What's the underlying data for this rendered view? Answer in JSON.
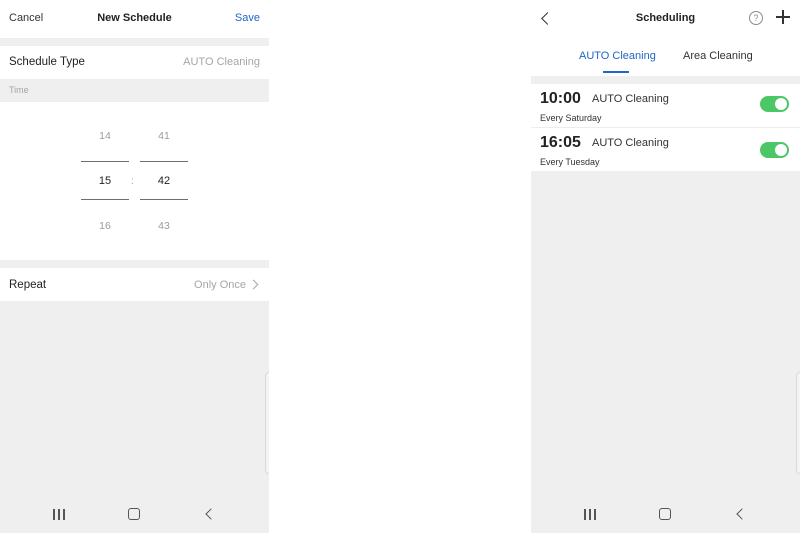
{
  "new_schedule": {
    "header": {
      "cancel": "Cancel",
      "title": "New Schedule",
      "save": "Save"
    },
    "schedule_type": {
      "label": "Schedule Type",
      "value": "AUTO Cleaning"
    },
    "time_section_label": "Time",
    "time_picker": {
      "hours": [
        "14",
        "15",
        "16"
      ],
      "minutes": [
        "41",
        "42",
        "43"
      ],
      "separator": ":"
    },
    "repeat": {
      "label": "Repeat",
      "value": "Only Once"
    }
  },
  "scheduling": {
    "header": {
      "title": "Scheduling",
      "help": "?"
    },
    "tabs": [
      {
        "label": "AUTO Cleaning",
        "active": true
      },
      {
        "label": "Area Cleaning",
        "active": false
      }
    ],
    "schedules": [
      {
        "time": "10:00",
        "type": "AUTO Cleaning",
        "repeat": "Every Saturday",
        "enabled": true
      },
      {
        "time": "16:05",
        "type": "AUTO Cleaning",
        "repeat": "Every Tuesday",
        "enabled": true
      }
    ]
  },
  "colors": {
    "accent": "#1f66c6",
    "toggle_on": "#4cc766",
    "background": "#efeff0"
  }
}
